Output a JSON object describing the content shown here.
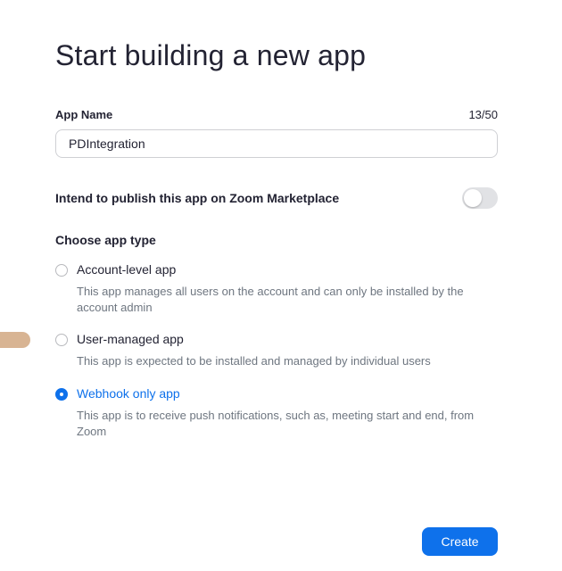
{
  "dialog": {
    "title": "Start building a new app",
    "app_name": {
      "label": "App Name",
      "char_count": "13/50",
      "value": "PDIntegration"
    },
    "publish": {
      "label": "Intend to publish this app on Zoom Marketplace",
      "enabled": false
    },
    "app_type": {
      "label": "Choose app type",
      "options": [
        {
          "label": "Account-level app",
          "description": "This app manages all users on the account and can only be installed by the account admin",
          "selected": false
        },
        {
          "label": "User-managed app",
          "description": "This app is expected to be installed and managed by individual users",
          "selected": false
        },
        {
          "label": "Webhook only app",
          "description": "This app is to receive push notifications, such as, meeting start and end, from Zoom",
          "selected": true
        }
      ]
    },
    "create_label": "Create"
  },
  "colors": {
    "accent": "#0e71eb",
    "text": "#232333",
    "muted": "#6e7680",
    "toggle_off": "#e1e2e5"
  }
}
